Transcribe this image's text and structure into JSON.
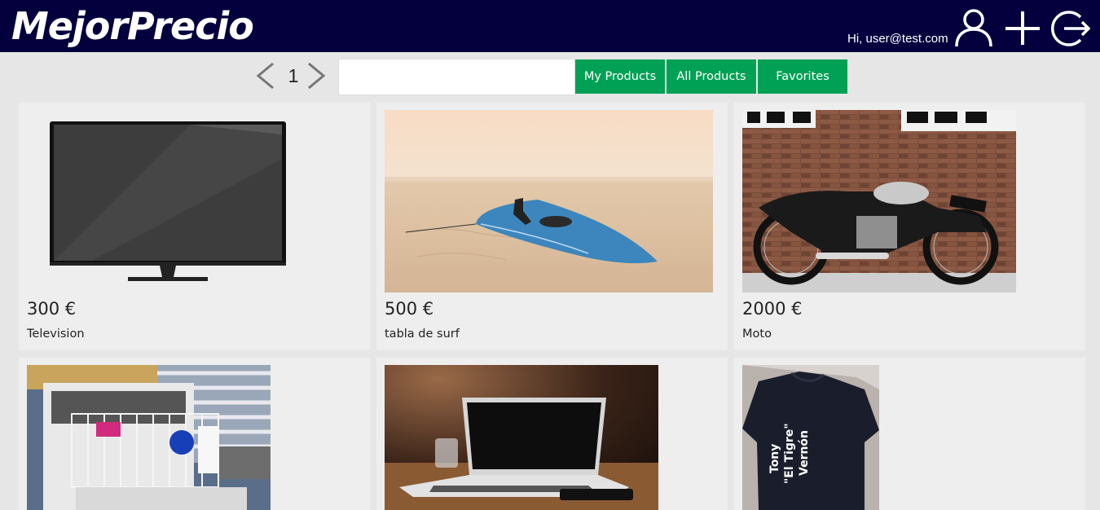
{
  "header": {
    "logo": "MejorPrecio",
    "greeting": "Hi, user@test.com",
    "icons": [
      "user-icon",
      "add-icon",
      "logout-icon"
    ]
  },
  "toolbar": {
    "page_number": "1",
    "search_value": "",
    "search_placeholder": "",
    "tabs": [
      "My Products",
      "All Products",
      "Favorites"
    ]
  },
  "products": [
    {
      "price": "300 €",
      "name": "Television",
      "image": "television"
    },
    {
      "price": "500 €",
      "name": "tabla de surf",
      "image": "surfboard-on-beach"
    },
    {
      "price": "2000 €",
      "name": "Moto",
      "image": "motorcycle"
    },
    {
      "price": "",
      "name": "",
      "image": "dishwasher"
    },
    {
      "price": "",
      "name": "",
      "image": "laptop"
    },
    {
      "price": "",
      "name": "",
      "image": "t-shirt",
      "image_text": [
        "Tony",
        "\"El Tigre\"",
        "Vernón"
      ]
    }
  ],
  "colors": {
    "header_bg": "#03003d",
    "accent_green": "#00a155",
    "page_bg": "#e6e6e6",
    "card_bg": "#eeeeee"
  }
}
